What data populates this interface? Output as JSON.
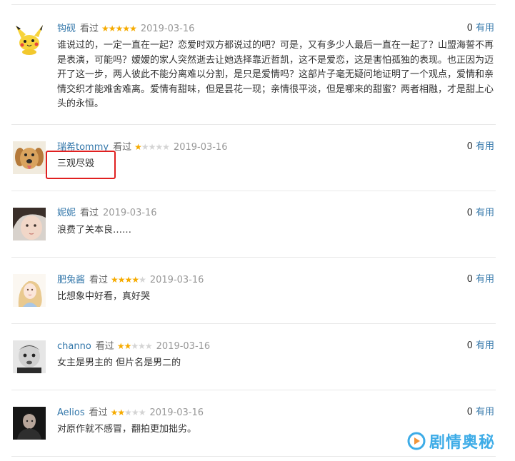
{
  "colors": {
    "username": "#3377aa",
    "star_on": "#f6ab00",
    "star_off": "#d4d4d4",
    "highlight_border": "#e02020",
    "watermark": "#2ea6e6"
  },
  "comments": [
    {
      "user": "钩砚",
      "watched": "看过",
      "rating": 5,
      "rating_max": 5,
      "date": "2019-03-16",
      "useful_count": "0",
      "useful_label": "有用",
      "avatar_icon": "pikachu-avatar",
      "text": "谁说过的，一定一直在一起？恋爱时双方都说过的吧？可是，又有多少人最后一直在一起了？山盟海誓不再是表演，可能吗？嫒嫒的家人突然逝去让她选择靠近哲凯，这不是爱恋，这是害怕孤独的表现。也正因为迈开了这一步，两人彼此不能分离难以分割，是只是爱情吗？这部片子毫无疑问地证明了一个观点，爱情和亲情交织才能难舍难离。爱情有甜味，但是昙花一现；亲情很平淡，但是哪来的甜蜜？两者相融，才是甜上心头的永恒。"
    },
    {
      "user": "瑞希tommy",
      "watched": "看过",
      "rating": 1,
      "rating_max": 5,
      "date": "2019-03-16",
      "useful_count": "0",
      "useful_label": "有用",
      "avatar_icon": "dog-avatar",
      "text": "三观尽毁"
    },
    {
      "user": "妮妮",
      "watched": "看过",
      "rating": 0,
      "rating_max": 0,
      "date": "2019-03-16",
      "useful_count": "0",
      "useful_label": "有用",
      "avatar_icon": "girl-avatar",
      "text": "浪费了关本良……"
    },
    {
      "user": "肥兔酱",
      "watched": "看过",
      "rating": 4,
      "rating_max": 5,
      "date": "2019-03-16",
      "useful_count": "0",
      "useful_label": "有用",
      "avatar_icon": "illustration-avatar",
      "text": "比想象中好看，真好哭"
    },
    {
      "user": "channo",
      "watched": "看过",
      "rating": 2,
      "rating_max": 5,
      "date": "2019-03-16",
      "useful_count": "0",
      "useful_label": "有用",
      "avatar_icon": "baby-avatar",
      "text": "女主是男主的 但片名是男二的"
    },
    {
      "user": "Aelios",
      "watched": "看过",
      "rating": 2,
      "rating_max": 5,
      "date": "2019-03-16",
      "useful_count": "0",
      "useful_label": "有用",
      "avatar_icon": "man-avatar",
      "text": "对原作就不感冒，翻拍更加拙劣。"
    }
  ],
  "watermark": {
    "text": "剧情奥秘",
    "icon": "watermark-logo-icon"
  }
}
